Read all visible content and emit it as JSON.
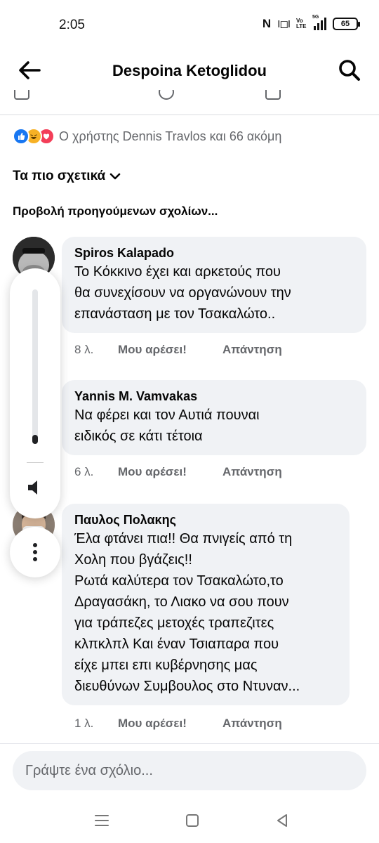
{
  "status_bar": {
    "time": "2:05",
    "nfc": "N",
    "vibrate": "I◻I",
    "volte": "Vo LTE",
    "network": "5G",
    "battery": "65"
  },
  "header": {
    "title": "Despoina Ketoglidou"
  },
  "reactions": {
    "summary": "Ο χρήστης Dennis Travlos και 66 ακόμη",
    "types": [
      "like-icon",
      "haha-icon",
      "love-icon"
    ]
  },
  "sort": {
    "label": "Τα πιο σχετικά"
  },
  "previous_comments": "Προβολή προηγούμενων σχολίων...",
  "comments": [
    {
      "author": "Spiros Kalapado",
      "lines": [
        "Το Κόκκινο έχει και αρκετούς που",
        "θα συνεχίσουν να οργανώνουν την",
        "επανάσταση με τον Τσακαλώτο.."
      ],
      "age": "8 λ.",
      "like": "Μου αρέσει!",
      "reply": "Απάντηση"
    },
    {
      "author": "Yannis M. Vamvakas",
      "lines": [
        "Να φέρει και τον Αυτιά πουναι",
        "ειδικός σε κάτι τέτοια"
      ],
      "age": "6 λ.",
      "like": "Μου αρέσει!",
      "reply": "Απάντηση"
    },
    {
      "author": "Παυλος Πολακης",
      "lines": [
        "Έλα φτάνει πια!! Θα πνιγείς από τη",
        "Χολη που βγάζεις!!",
        "Ρωτά καλύτερα τον Τσακαλώτο,το",
        "Δραγασάκη, το Λιακο να σου πουν",
        "για τράπεζες μετοχές τραπεζιτες",
        "κλπκλπλ Και έναν Τσιαπαρα που",
        "είχε μπει επι κυβέρνησης  μας",
        "διευθύνων Συμβουλος  στο Ντυναν..."
      ],
      "age": "1 λ.",
      "like": "Μου αρέσει!",
      "reply": "Απάντηση"
    }
  ],
  "volume_panel": {
    "level_fraction": 0.06
  },
  "composer": {
    "placeholder": "Γράψτε ένα σχόλιο..."
  },
  "colors": {
    "facebook_blue": "#1877f2",
    "bubble_bg": "#f0f2f5",
    "secondary_text": "#65676b"
  }
}
